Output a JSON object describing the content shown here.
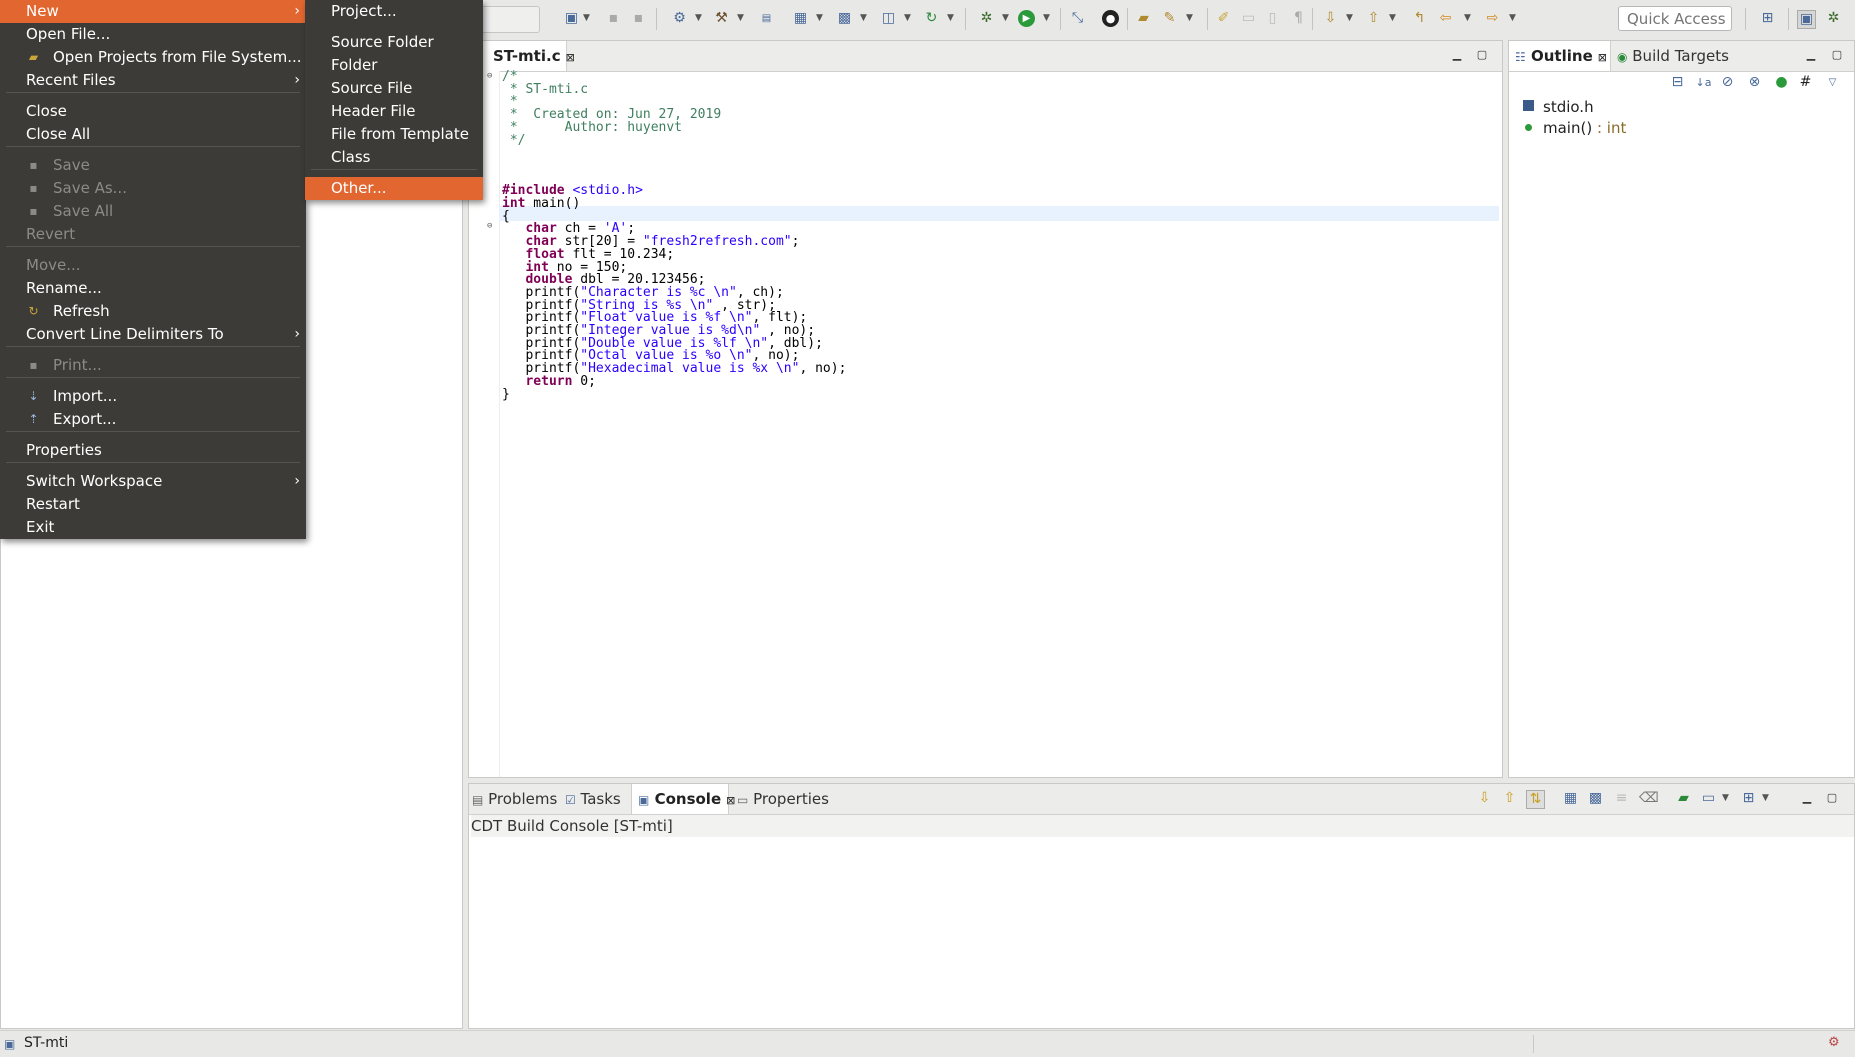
{
  "toolbar": {
    "quick_access_placeholder": "Quick Access"
  },
  "file_menu": {
    "items": [
      {
        "label": "New",
        "arrow": true
      },
      {
        "label": "Open File..."
      },
      {
        "label": "Open Projects from File System..."
      },
      {
        "label": "Recent Files",
        "arrow": true
      },
      {
        "label": "Close"
      },
      {
        "label": "Close All"
      },
      {
        "label": "Save"
      },
      {
        "label": "Save As..."
      },
      {
        "label": "Save All"
      },
      {
        "label": "Revert"
      },
      {
        "label": "Move..."
      },
      {
        "label": "Rename..."
      },
      {
        "label": "Refresh"
      },
      {
        "label": "Convert Line Delimiters To",
        "arrow": true
      },
      {
        "label": "Print..."
      },
      {
        "label": "Import..."
      },
      {
        "label": "Export..."
      },
      {
        "label": "Properties"
      },
      {
        "label": "Switch Workspace",
        "arrow": true
      },
      {
        "label": "Restart"
      },
      {
        "label": "Exit"
      }
    ],
    "arrow_glyph": "›"
  },
  "new_submenu": {
    "items": [
      {
        "label": "Project..."
      },
      {
        "label": "Source Folder"
      },
      {
        "label": "Folder"
      },
      {
        "label": "Source File"
      },
      {
        "label": "Header File"
      },
      {
        "label": "File from Template"
      },
      {
        "label": "Class"
      },
      {
        "label": "Other..."
      }
    ]
  },
  "editor": {
    "tab_label": "ST-mti.c",
    "close_glyph": "⊠",
    "lines": [
      "/*",
      " * ST-mti.c",
      " *",
      " *  Created on: Jun 27, 2019",
      " *      Author: huyenvt",
      " */",
      "",
      "",
      "",
      "#include <stdio.h>",
      "int main()",
      "{",
      "   char ch = 'A';",
      "   char str[20] = \"fresh2refresh.com\";",
      "   float flt = 10.234;",
      "   int no = 150;",
      "   double dbl = 20.123456;",
      "   printf(\"Character is %c \\n\", ch);",
      "   printf(\"String is %s \\n\" , str);",
      "   printf(\"Float value is %f \\n\", flt);",
      "   printf(\"Integer value is %d\\n\" , no);",
      "   printf(\"Double value is %lf \\n\", dbl);",
      "   printf(\"Octal value is %o \\n\", no);",
      "   printf(\"Hexadecimal value is %x \\n\", no);",
      "   return 0;",
      "}"
    ]
  },
  "outline": {
    "tabs": [
      "Outline",
      "Build Targets"
    ],
    "items": [
      {
        "label": "stdio.h"
      },
      {
        "label": "main()",
        "type": " : int"
      }
    ]
  },
  "bottom_panel": {
    "tabs": [
      "Problems",
      "Tasks",
      "Console",
      "Properties"
    ],
    "console_title": "CDT Build Console [ST-mti]"
  },
  "status": {
    "project": "ST-mti"
  },
  "colors": {
    "menu_bg": "#3c3b37",
    "menu_highlight": "#e2662f",
    "keyword": "#7f0055",
    "string": "#2a00ff",
    "comment": "#3f7f5f"
  }
}
